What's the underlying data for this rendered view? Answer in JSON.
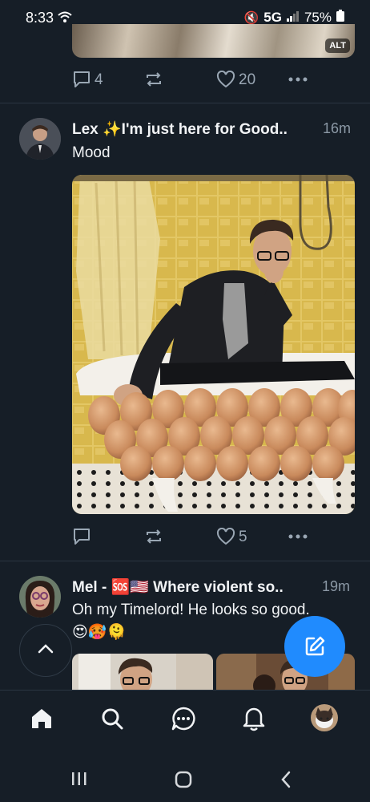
{
  "status_bar": {
    "time": "8:33",
    "network": "5G",
    "battery": "75%"
  },
  "previous_post": {
    "alt_badge": "ALT",
    "reply_count": "4",
    "like_count": "20"
  },
  "post1": {
    "author": "Lex ✨I'm just here for Good..",
    "time_ago": "16m",
    "text": "Mood",
    "like_count": "5"
  },
  "post2": {
    "author": "Mel - 🆘🇺🇸 Where violent so..",
    "time_ago": "19m",
    "text": "Oh my Timelord! He looks so good. 😍🥵🫠"
  },
  "icons": {
    "reply": "reply-icon",
    "repost": "repost-icon",
    "like": "heart-icon",
    "more": "more-icon",
    "compose": "compose-icon",
    "scroll_top": "chevron-up-icon",
    "nav": [
      "home-icon",
      "search-icon",
      "chat-icon",
      "bell-icon",
      "avatar"
    ]
  },
  "colors": {
    "background": "#161e27",
    "accent": "#208bfe",
    "muted": "#8b98a5"
  }
}
